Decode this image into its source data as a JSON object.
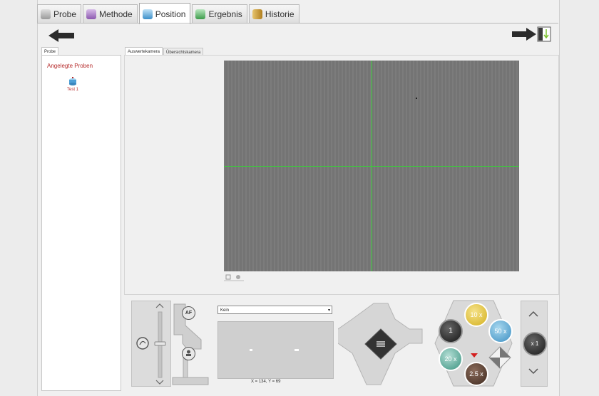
{
  "tabs": [
    {
      "label": "Probe",
      "color": "#b8b8b8"
    },
    {
      "label": "Methode",
      "color": "#a77cc6"
    },
    {
      "label": "Position",
      "color": "#5aa7d9",
      "active": true
    },
    {
      "label": "Ergebnis",
      "color": "#4fb85f"
    },
    {
      "label": "Historie",
      "color": "#d4a136"
    }
  ],
  "left_panel": {
    "tab_label": "Probe",
    "tree_title": "Angelegte Proben",
    "items": [
      {
        "label": "Test 1"
      }
    ]
  },
  "camera": {
    "tabs": [
      "Auswertekamera",
      "Übersichtskamera"
    ],
    "crosshair_color": "#37d037"
  },
  "controls": {
    "focus_buttons": [
      "AF"
    ],
    "dropdown_value": "Kein",
    "coordinate_readout": "X = 134, Y = 69",
    "objectives": [
      "1",
      "10 x",
      "50 x",
      "20 x",
      "2.5 x"
    ],
    "zoom_label": "x 1"
  },
  "icons": [
    "back-arrow-icon",
    "export-arrow-icon",
    "scroll-up-icon",
    "scroll-down-icon",
    "joystick-menu-icon"
  ]
}
